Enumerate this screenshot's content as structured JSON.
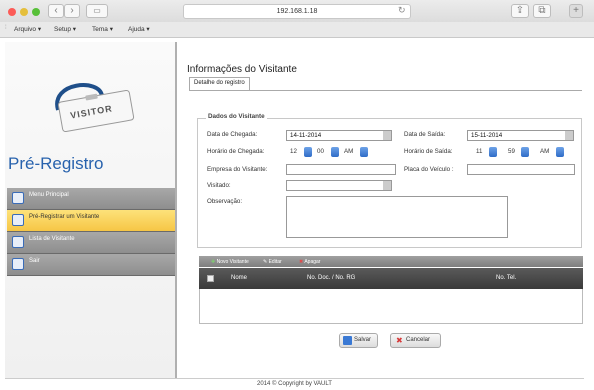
{
  "browser": {
    "url": "192.168.1.18",
    "back_icon": "chevron-left-icon",
    "forward_icon": "chevron-right-icon",
    "reload_icon": "reload-icon"
  },
  "menubar": {
    "items": [
      "Arquivo",
      "Setup",
      "Tema",
      "Ajuda"
    ]
  },
  "sidebar": {
    "badge_text": "VISITOR",
    "title": "Pré-Registro",
    "items": [
      {
        "label": "Menu Principal",
        "icon": "home-icon"
      },
      {
        "label": "Pré-Registrar um Visitante",
        "icon": "register-icon"
      },
      {
        "label": "Lista de Visitante",
        "icon": "list-icon"
      },
      {
        "label": "Sair",
        "icon": "exit-icon"
      }
    ]
  },
  "page": {
    "title": "Informações do Visitante",
    "tab": "Detalhe do registro",
    "section": "Dados do Visitante"
  },
  "form": {
    "arrival_label": "Data de Chegada:",
    "arrival_value": "14-11-2014",
    "departure_label": "Data de Saída:",
    "departure_value": "15-11-2014",
    "arrival_time_label": "Horário de Chegada:",
    "arrival_hour": "12",
    "arrival_min": "00",
    "arrival_ampm": "AM",
    "departure_time_label": "Horário de Saída:",
    "departure_hour": "11",
    "departure_min": "59",
    "departure_ampm": "AM",
    "company_label": "Empresa do Visitante:",
    "plate_label": "Placa do Veículo :",
    "visited_label": "Visitado:",
    "notes_label": "Observação:"
  },
  "grid": {
    "toolbar": [
      "Novo Visitante",
      "Editar",
      "Apagar"
    ],
    "columns": [
      "Nome",
      "No. Doc. / No. RG",
      "No. Tel."
    ]
  },
  "actions": {
    "save": "Salvar",
    "cancel": "Cancelar"
  },
  "footer": "2014 © Copyright by VAULT"
}
